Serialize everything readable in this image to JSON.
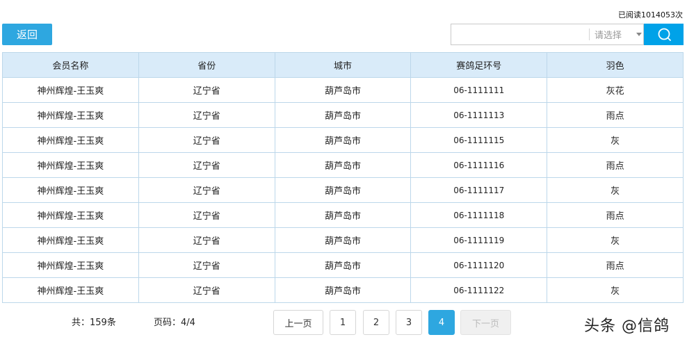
{
  "header": {
    "read_count": "已阅读1014053次"
  },
  "toolbar": {
    "back_label": "返回"
  },
  "search": {
    "value": "",
    "select_placeholder": "请选择"
  },
  "table": {
    "columns": [
      "会员名称",
      "省份",
      "城市",
      "赛鸽足环号",
      "羽色"
    ],
    "rows": [
      [
        "神州辉煌-王玉爽",
        "辽宁省",
        "葫芦岛市",
        "06-1111111",
        "灰花"
      ],
      [
        "神州辉煌-王玉爽",
        "辽宁省",
        "葫芦岛市",
        "06-1111113",
        "雨点"
      ],
      [
        "神州辉煌-王玉爽",
        "辽宁省",
        "葫芦岛市",
        "06-1111115",
        "灰"
      ],
      [
        "神州辉煌-王玉爽",
        "辽宁省",
        "葫芦岛市",
        "06-1111116",
        "雨点"
      ],
      [
        "神州辉煌-王玉爽",
        "辽宁省",
        "葫芦岛市",
        "06-1111117",
        "灰"
      ],
      [
        "神州辉煌-王玉爽",
        "辽宁省",
        "葫芦岛市",
        "06-1111118",
        "雨点"
      ],
      [
        "神州辉煌-王玉爽",
        "辽宁省",
        "葫芦岛市",
        "06-1111119",
        "灰"
      ],
      [
        "神州辉煌-王玉爽",
        "辽宁省",
        "葫芦岛市",
        "06-1111120",
        "雨点"
      ],
      [
        "神州辉煌-王玉爽",
        "辽宁省",
        "葫芦岛市",
        "06-1111122",
        "灰"
      ]
    ]
  },
  "footer": {
    "total": "共：159条",
    "page_info": "页码：4/4",
    "prev_label": "上一页",
    "next_label": "下一页",
    "pages": [
      "1",
      "2",
      "3",
      "4"
    ],
    "current_page": "4"
  },
  "watermark": "头条 @信鸽",
  "colors": {
    "accent": "#2ea7e0",
    "header_bg": "#d9ebf9",
    "border": "#bcd7ea"
  },
  "icons": {
    "search": "search-icon",
    "dropdown": "chevron-down-icon"
  }
}
